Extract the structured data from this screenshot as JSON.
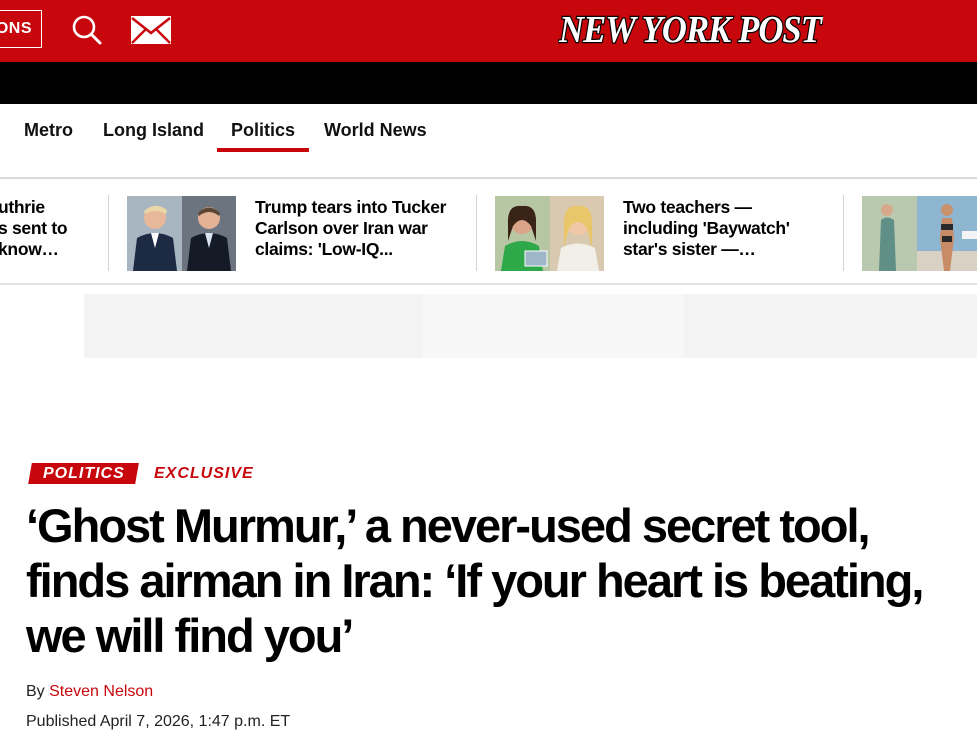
{
  "header": {
    "subscribe_label": "ONS",
    "logo_text": "NEW YORK POST",
    "search_icon": "search-icon",
    "mail_icon": "mail-icon"
  },
  "nav": {
    "items": [
      {
        "label": "Metro",
        "active": false
      },
      {
        "label": "Long Island",
        "active": false
      },
      {
        "label": "Politics",
        "active": true
      },
      {
        "label": "World News",
        "active": false
      }
    ]
  },
  "trending": {
    "stories": [
      {
        "title_lines": [
          "uthrie",
          "s sent to",
          "know…"
        ]
      },
      {
        "title_lines": [
          "Trump tears into Tucker",
          "Carlson over Iran war",
          "claims: 'Low-IQ..."
        ]
      },
      {
        "title_lines": [
          "Two teachers —",
          "including 'Baywatch'",
          "star's sister —…"
        ]
      }
    ]
  },
  "article": {
    "section_badge": "POLITICS",
    "exclusive_badge": "EXCLUSIVE",
    "headline": "‘Ghost Murmur,’ a never-used secret tool, finds airman in Iran: ‘If your heart is beating, we will find you’",
    "byline_prefix": "By",
    "author": "Steven Nelson",
    "published": "Published April 7, 2026, 1:47 p.m. ET"
  },
  "colors": {
    "brand_red": "#c8070c",
    "black_bar": "#000000"
  }
}
